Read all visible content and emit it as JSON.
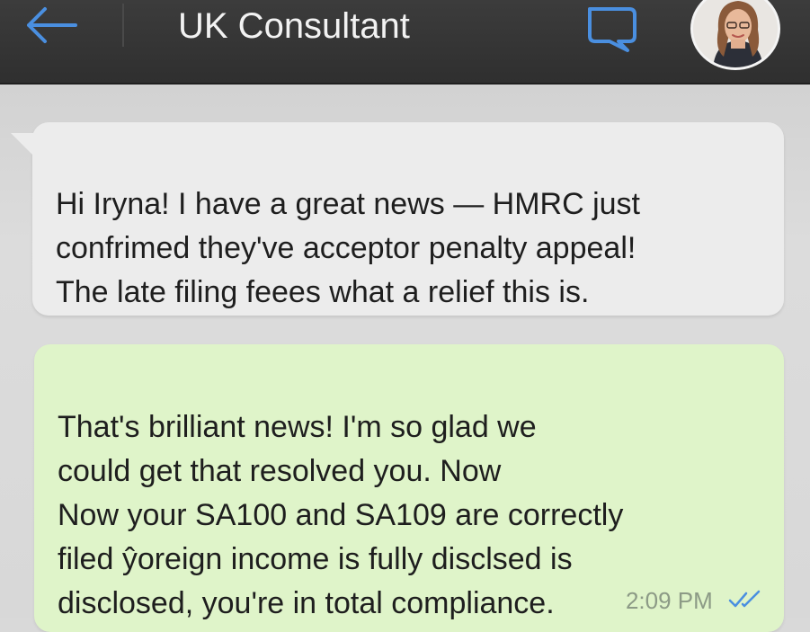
{
  "header": {
    "title": "UK Consultant",
    "back_icon": "arrow-left-icon",
    "chat_icon": "chat-bubble-icon",
    "accent_color": "#4a8fe0",
    "background_color": "#333333"
  },
  "messages": [
    {
      "direction": "incoming",
      "text": "Hi Iryna! I have a great news — HMRC just\nconfrimed they've acceptor penalty appeal!\nThe late filing feees what a relief this is.",
      "bubble_color": "#ececec"
    },
    {
      "direction": "outgoing",
      "text": "That's brilliant news! I'm so glad we\ncould get that resolved you. Now\nNow your SA100 and SA109 are correctly\nfiled ŷoreign income is fully disclsed is\ndisclosed, you're in total compliance.",
      "time": "2:09 PM",
      "status_icon": "double-check-icon",
      "bubble_color": "#dff4c9"
    }
  ]
}
